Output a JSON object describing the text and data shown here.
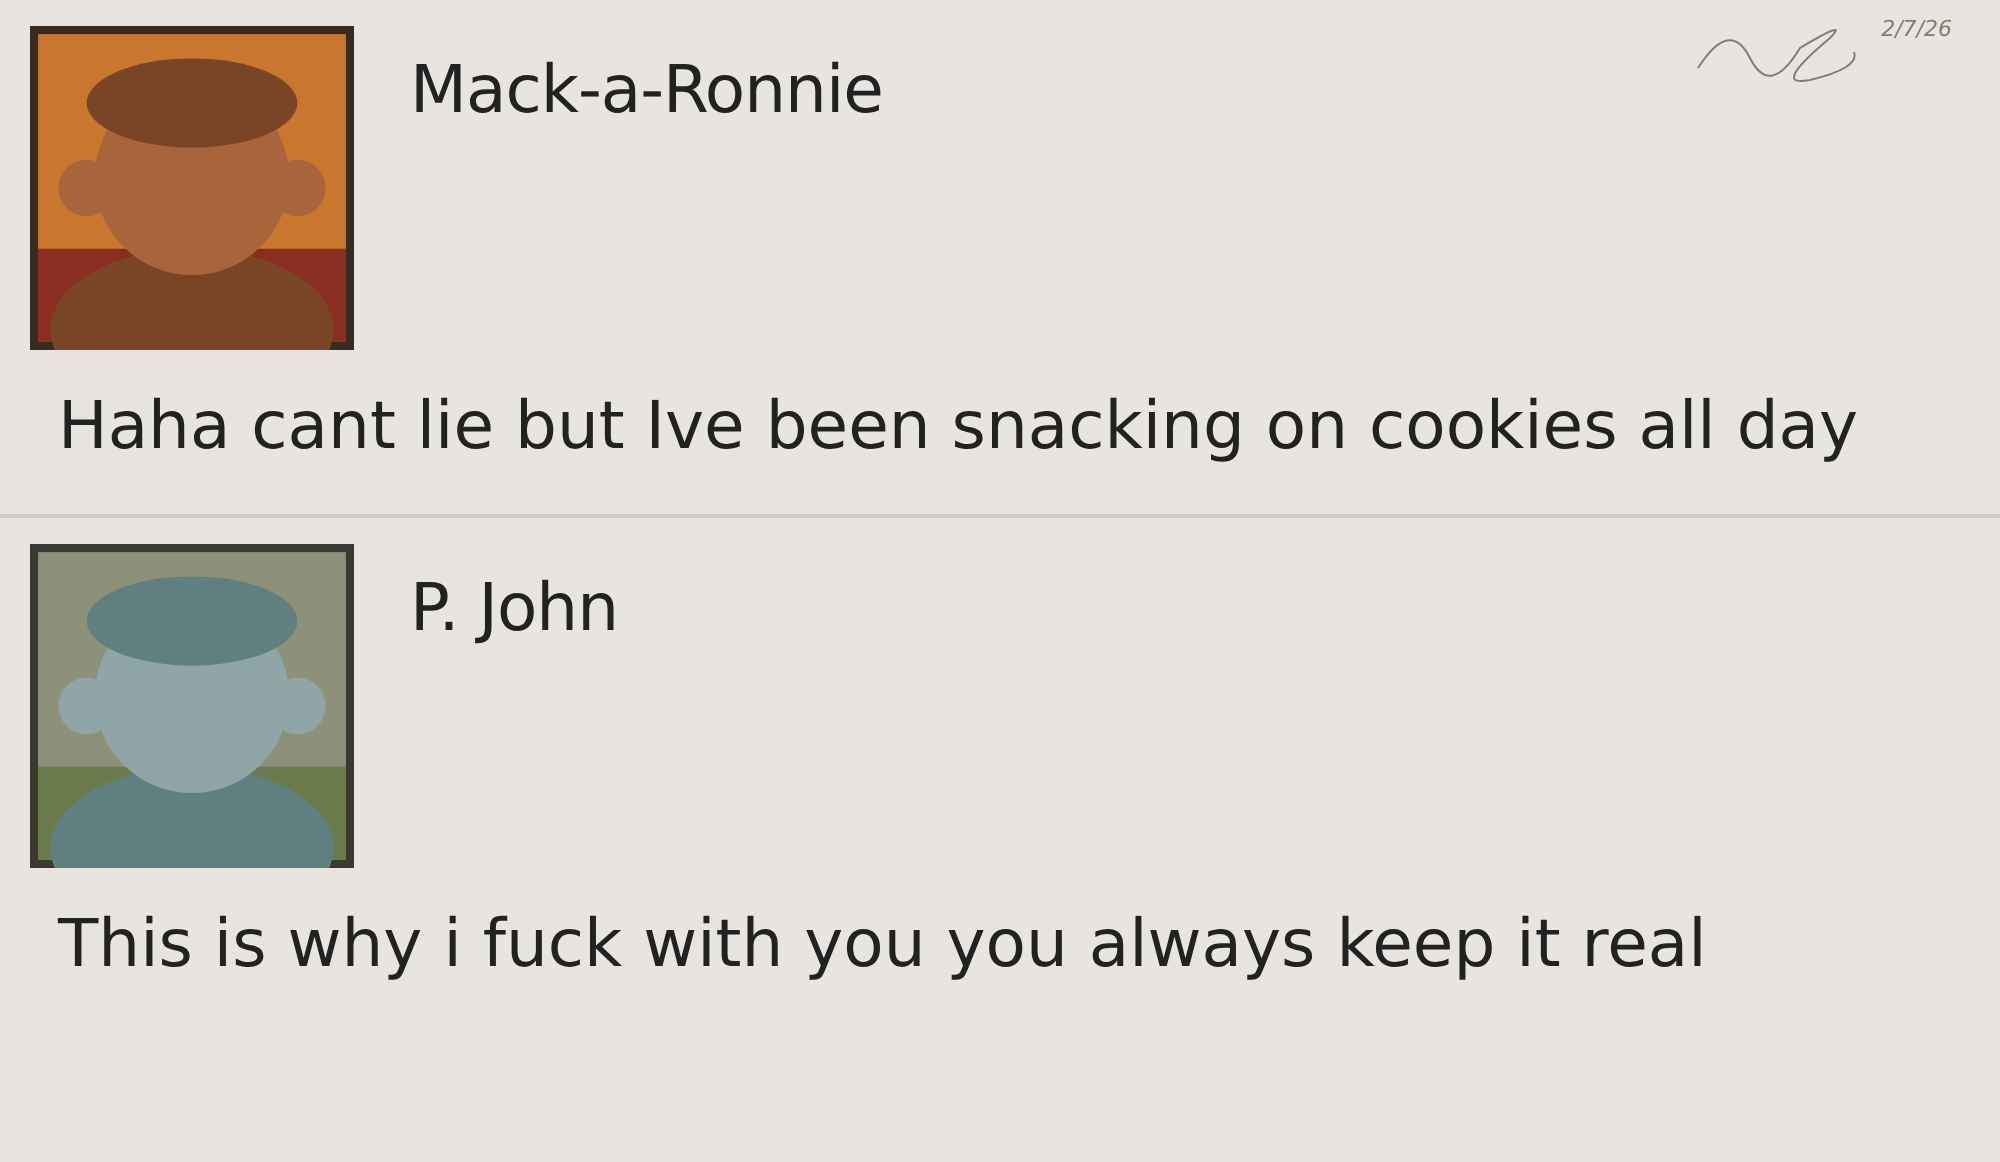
{
  "signature": {
    "date": "2/7/26"
  },
  "posts": [
    {
      "author": "Mack-a-Ronnie",
      "message": "Haha cant lie but Ive been snacking on cookies all day"
    },
    {
      "author": "P. John",
      "message": "This is why i fuck with you you always keep it real"
    }
  ]
}
